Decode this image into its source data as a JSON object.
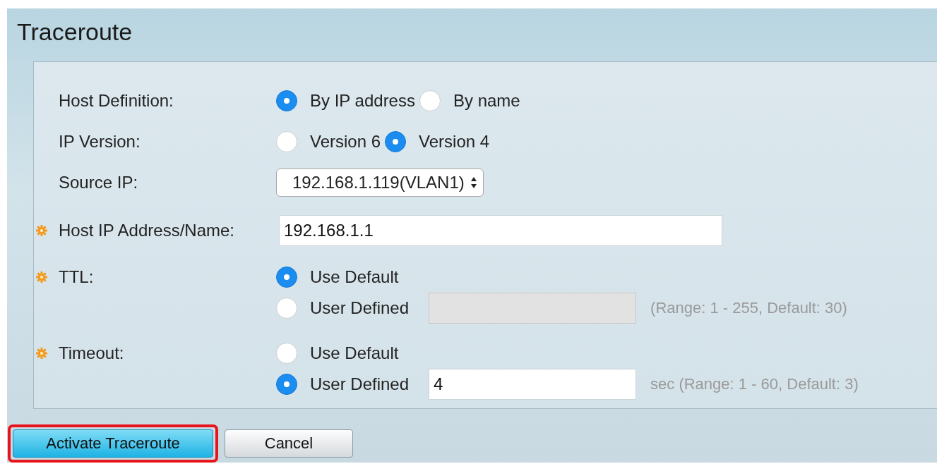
{
  "title": "Traceroute",
  "fields": [
    {
      "kind": "radio",
      "label": "Host Definition:",
      "required": false,
      "options": [
        {
          "label": "By IP address",
          "selected": true
        },
        {
          "label": "By name",
          "selected": false
        }
      ]
    },
    {
      "kind": "radio",
      "label": "IP Version:",
      "required": false,
      "options": [
        {
          "label": "Version 6",
          "selected": false
        },
        {
          "label": "Version 4",
          "selected": true
        }
      ]
    },
    {
      "kind": "select",
      "label": "Source IP:",
      "required": false,
      "value": "192.168.1.119(VLAN1)"
    },
    {
      "kind": "text",
      "label": "Host IP Address/Name:",
      "required": true,
      "value": "192.168.1.1"
    },
    {
      "kind": "stack",
      "label": "TTL:",
      "required": true,
      "options": [
        {
          "label": "Use Default",
          "selected": true
        },
        {
          "label": "User Defined",
          "selected": false
        }
      ],
      "input_disabled": true,
      "hint": "(Range: 1 - 255, Default: 30)"
    },
    {
      "kind": "stack",
      "label": "Timeout:",
      "required": true,
      "options": [
        {
          "label": "Use Default",
          "selected": false
        },
        {
          "label": "User Defined",
          "selected": true
        }
      ],
      "input_disabled": false,
      "value": "4",
      "hint": "sec (Range: 1 - 60, Default: 3)"
    }
  ],
  "buttons": [
    {
      "label": "Activate Traceroute",
      "primary": true,
      "highlighted": true
    },
    {
      "label": "Cancel",
      "primary": false,
      "highlighted": false
    }
  ]
}
